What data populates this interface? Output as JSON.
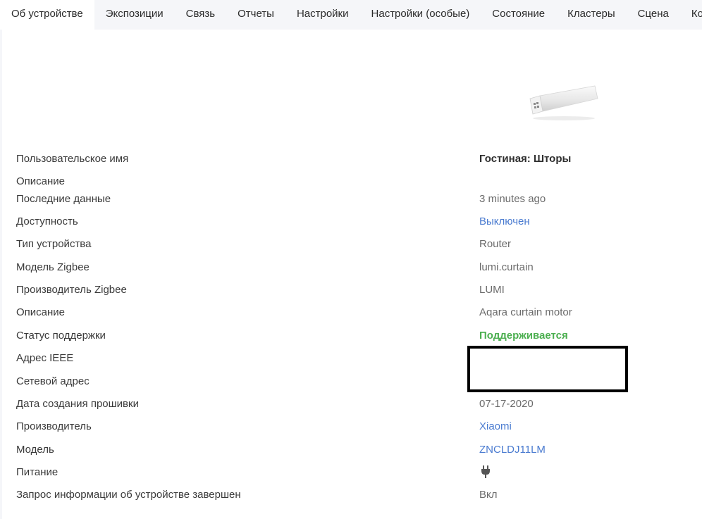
{
  "tabs": [
    {
      "label": "Об устройстве",
      "active": true
    },
    {
      "label": "Экспозиции"
    },
    {
      "label": "Связь"
    },
    {
      "label": "Отчеты"
    },
    {
      "label": "Настройки"
    },
    {
      "label": "Настройки (особые)"
    },
    {
      "label": "Состояние"
    },
    {
      "label": "Кластеры"
    },
    {
      "label": "Сцена"
    },
    {
      "label": "Кон"
    }
  ],
  "device": {
    "image_icon": "curtain-motor-image"
  },
  "info": {
    "friendly_name": {
      "label": "Пользовательское имя",
      "value": "Гостиная: Шторы"
    },
    "description": {
      "label": "Описание"
    },
    "last_seen": {
      "label": "Последние данные",
      "value": "3 minutes ago"
    },
    "availability": {
      "label": "Доступность",
      "value": "Выключен"
    },
    "device_type": {
      "label": "Тип устройства",
      "value": "Router"
    },
    "zigbee_model": {
      "label": "Модель Zigbee",
      "value": "lumi.curtain"
    },
    "zigbee_manufacturer": {
      "label": "Производитель Zigbee",
      "value": "LUMI"
    },
    "model_description": {
      "label": "Описание",
      "value": "Aqara curtain motor"
    },
    "support_status": {
      "label": "Статус поддержки",
      "value": "Поддерживается"
    },
    "ieee_address": {
      "label": "Адрес IEEE"
    },
    "network_address": {
      "label": "Сетевой адрес"
    },
    "firmware_date": {
      "label": "Дата создания прошивки",
      "value": "07-17-2020"
    },
    "manufacturer": {
      "label": "Производитель",
      "value": "Xiaomi"
    },
    "model": {
      "label": "Модель",
      "value": "ZNCLDJ11LM"
    },
    "power": {
      "label": "Питание",
      "icon": "plug-icon"
    },
    "interview": {
      "label": "Запрос информации об устройстве завершен",
      "value": "Вкл"
    }
  },
  "colors": {
    "link": "#4a7bd0",
    "supported": "#4caf50",
    "tabbar_bg": "#f5f6f9"
  }
}
